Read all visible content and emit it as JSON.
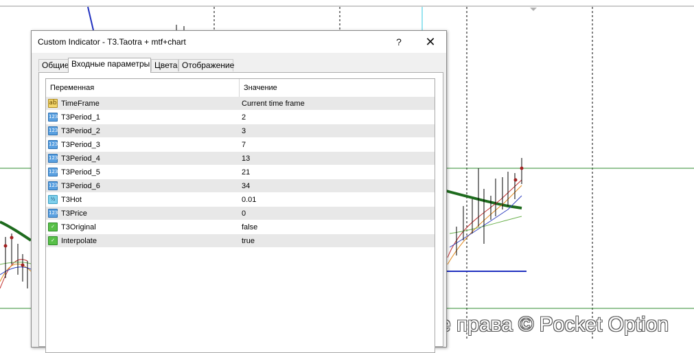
{
  "dialog": {
    "title": "Custom Indicator - T3.Taotra + mtf+chart",
    "help_label": "?",
    "close_label": "✕"
  },
  "tabs": [
    {
      "label": "Общие",
      "active": false
    },
    {
      "label": "Входные параметры",
      "active": true
    },
    {
      "label": "Цвета",
      "active": false
    },
    {
      "label": "Отображение",
      "active": false
    }
  ],
  "table": {
    "headers": {
      "variable": "Переменная",
      "value": "Значение"
    },
    "rows": [
      {
        "icon": "ab",
        "variable": "TimeFrame",
        "value": "Current time frame"
      },
      {
        "icon": "123",
        "variable": "T3Period_1",
        "value": "2"
      },
      {
        "icon": "123",
        "variable": "T3Period_2",
        "value": "3"
      },
      {
        "icon": "123",
        "variable": "T3Period_3",
        "value": "7"
      },
      {
        "icon": "123",
        "variable": "T3Period_4",
        "value": "13"
      },
      {
        "icon": "123",
        "variable": "T3Period_5",
        "value": "21"
      },
      {
        "icon": "123",
        "variable": "T3Period_6",
        "value": "34"
      },
      {
        "icon": "1/2",
        "variable": "T3Hot",
        "value": "0.01"
      },
      {
        "icon": "123",
        "variable": "T3Price",
        "value": "0"
      },
      {
        "icon": "bool",
        "variable": "T3Original",
        "value": "false"
      },
      {
        "icon": "bool",
        "variable": "Interpolate",
        "value": "true"
      }
    ]
  },
  "watermark": "Авторские права © Pocket Option",
  "colors": {
    "level_line": "#2e8b2e",
    "ma_thick": "#1e6b1e",
    "blue_line": "#1f2fbf",
    "cyan_line": "#33c8e0",
    "dashed_line": "#000000"
  }
}
